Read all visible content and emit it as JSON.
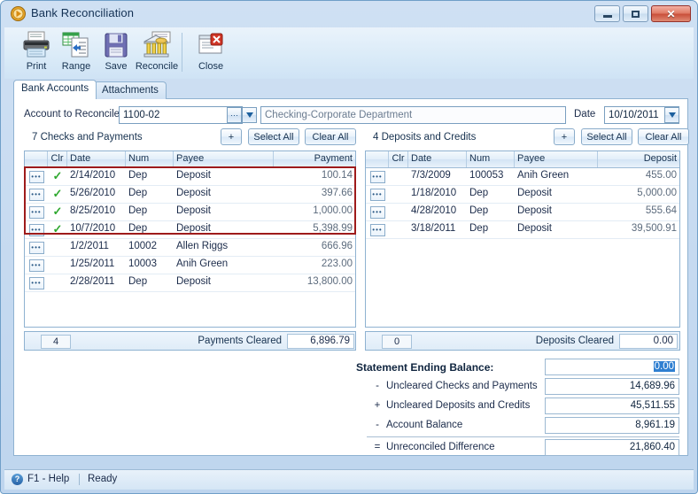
{
  "window": {
    "title": "Bank Reconciliation",
    "icon": "play-circle-icon",
    "buttons": {
      "minimize": "minimize-icon",
      "maximize": "maximize-icon",
      "close": "✕"
    }
  },
  "toolbar": {
    "items": [
      {
        "label": "Print",
        "icon": "printer-icon"
      },
      {
        "label": "Range",
        "icon": "range-grid-icon"
      },
      {
        "label": "Save",
        "icon": "floppy-disk-icon"
      },
      {
        "label": "Reconcile",
        "icon": "bank-icon"
      },
      {
        "label": "Close",
        "icon": "close-window-icon"
      }
    ]
  },
  "tabs": [
    {
      "label": "Bank Accounts",
      "active": true
    },
    {
      "label": "Attachments",
      "active": false
    }
  ],
  "account": {
    "label": "Account to Reconcile",
    "value": "1100-02",
    "description": "Checking-Corporate Department",
    "ellipsis_glyph": "⋯",
    "chevron_glyph": "⌄",
    "date_label": "Date",
    "date_value": "10/10/2011"
  },
  "left_list": {
    "title": "7 Checks and Payments",
    "add_label": "+",
    "select_all_label": "Select All",
    "clear_all_label": "Clear All",
    "columns": [
      "",
      "Clr",
      "Date",
      "Num",
      "Payee",
      "Payment"
    ],
    "rows": [
      {
        "cleared": true,
        "date": "2/14/2010",
        "num": "Dep",
        "payee": "Deposit",
        "amount": "100.14"
      },
      {
        "cleared": true,
        "date": "5/26/2010",
        "num": "Dep",
        "payee": "Deposit",
        "amount": "397.66"
      },
      {
        "cleared": true,
        "date": "8/25/2010",
        "num": "Dep",
        "payee": "Deposit",
        "amount": "1,000.00"
      },
      {
        "cleared": true,
        "date": "10/7/2010",
        "num": "Dep",
        "payee": "Deposit",
        "amount": "5,398.99"
      },
      {
        "cleared": false,
        "date": "1/2/2011",
        "num": "10002",
        "payee": "Allen Riggs",
        "amount": "666.96"
      },
      {
        "cleared": false,
        "date": "1/25/2011",
        "num": "10003",
        "payee": "Anih Green",
        "amount": "223.00"
      },
      {
        "cleared": false,
        "date": "2/28/2011",
        "num": "Dep",
        "payee": "Deposit",
        "amount": "13,800.00"
      }
    ],
    "footer": {
      "count": "4",
      "label": "Payments Cleared",
      "value": "6,896.79"
    }
  },
  "right_list": {
    "title": "4  Deposits and Credits",
    "add_label": "+",
    "select_all_label": "Select All",
    "clear_all_label": "Clear All",
    "columns": [
      "",
      "Clr",
      "Date",
      "Num",
      "Payee",
      "Deposit"
    ],
    "rows": [
      {
        "cleared": false,
        "date": "7/3/2009",
        "num": "100053",
        "payee": "Anih Green",
        "amount": "455.00"
      },
      {
        "cleared": false,
        "date": "1/18/2010",
        "num": "Dep",
        "payee": "Deposit",
        "amount": "5,000.00"
      },
      {
        "cleared": false,
        "date": "4/28/2010",
        "num": "Dep",
        "payee": "Deposit",
        "amount": "555.64"
      },
      {
        "cleared": false,
        "date": "3/18/2011",
        "num": "Dep",
        "payee": "Deposit",
        "amount": "39,500.91"
      }
    ],
    "footer": {
      "count": "0",
      "label": "Deposits Cleared",
      "value": "0.00"
    }
  },
  "summary": {
    "title": "Statement Ending Balance:",
    "ending_balance_value": "0.00",
    "rows": [
      {
        "op": "-",
        "label": "Uncleared Checks and Payments",
        "value": "14,689.96"
      },
      {
        "op": "+",
        "label": "Uncleared Deposits and Credits",
        "value": "45,511.55"
      },
      {
        "op": "-",
        "label": "Account Balance",
        "value": "8,961.19"
      }
    ],
    "total": {
      "op": "=",
      "label": "Unreconciled Difference",
      "value": "21,860.40"
    }
  },
  "statusbar": {
    "help_icon": "?",
    "help_text": "F1 - Help",
    "status_text": "Ready"
  },
  "colors": {
    "accent": "#2f7fd1",
    "selection_box": "#9e1b1b",
    "check_green": "#2fa82f",
    "frame": "#6f9fc8"
  }
}
